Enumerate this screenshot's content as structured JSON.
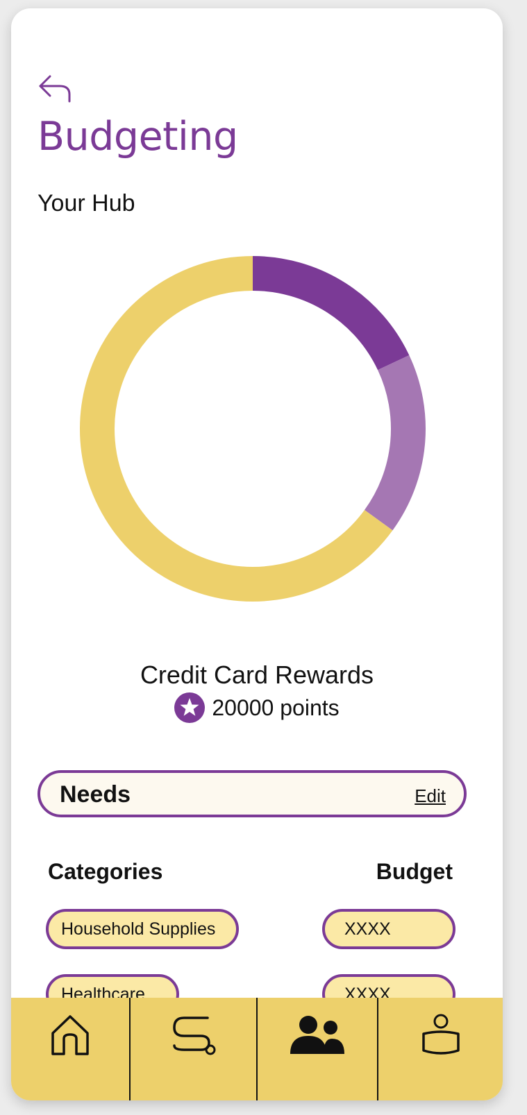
{
  "header": {
    "title": "Budgeting",
    "subtitle": "Your Hub",
    "back_icon": "back-arrow-icon"
  },
  "chart_data": {
    "type": "pie",
    "donut": true,
    "slices": [
      {
        "value": 18,
        "color": "#7b3a96"
      },
      {
        "value": 17,
        "color": "#a577b3"
      },
      {
        "value": 65,
        "color": "#edd06b"
      }
    ]
  },
  "rewards": {
    "title": "Credit Card Rewards",
    "points": "20000 points",
    "icon": "star-icon"
  },
  "needs": {
    "label": "Needs",
    "edit": "Edit"
  },
  "table": {
    "col_categories": "Categories",
    "col_budget": "Budget",
    "rows": [
      {
        "category": "Household Supplies",
        "budget": "XXXX"
      },
      {
        "category": "Healthcare",
        "budget": "XXXX"
      }
    ]
  },
  "nav": {
    "items": [
      "home-icon",
      "route-icon",
      "community-icon",
      "profile-icon"
    ],
    "color": "#edd06b"
  },
  "colors": {
    "accent": "#7b3a96",
    "pill_fill": "#fbe9a6"
  }
}
